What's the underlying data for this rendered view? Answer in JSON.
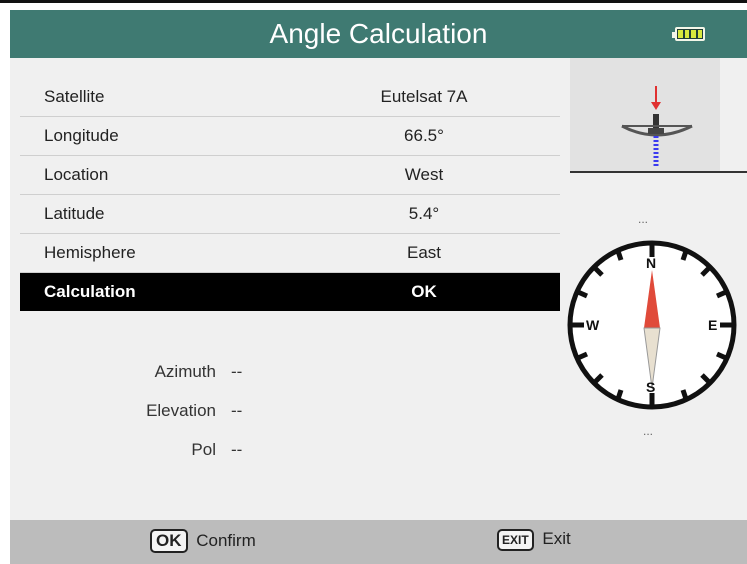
{
  "header": {
    "title": "Angle Calculation",
    "battery_icon": "battery-full-icon",
    "accent": "#3f7a72"
  },
  "settings": {
    "rows": [
      {
        "label": "Satellite",
        "value": "Eutelsat 7A"
      },
      {
        "label": "Longitude",
        "value": "66.5°"
      },
      {
        "label": "Location",
        "value": "West"
      },
      {
        "label": "Latitude",
        "value": "5.4°"
      },
      {
        "label": "Hemisphere",
        "value": "East"
      },
      {
        "label": "Calculation",
        "value": "OK"
      }
    ],
    "selected": "Calculation"
  },
  "results": {
    "azimuth_label": "Azimuth",
    "azimuth_value": "--",
    "elevation_label": "Elevation",
    "elevation_value": "--",
    "pol_label": "Pol",
    "pol_value": "--"
  },
  "indicators": {
    "dish_readout": "...",
    "compass_readout": "..."
  },
  "compass": {
    "north": "N",
    "south": "S",
    "east": "E",
    "west": "W"
  },
  "footer": {
    "confirm_key": "OK",
    "confirm_label": "Confirm",
    "exit_key": "EXIT",
    "exit_label": "Exit"
  }
}
